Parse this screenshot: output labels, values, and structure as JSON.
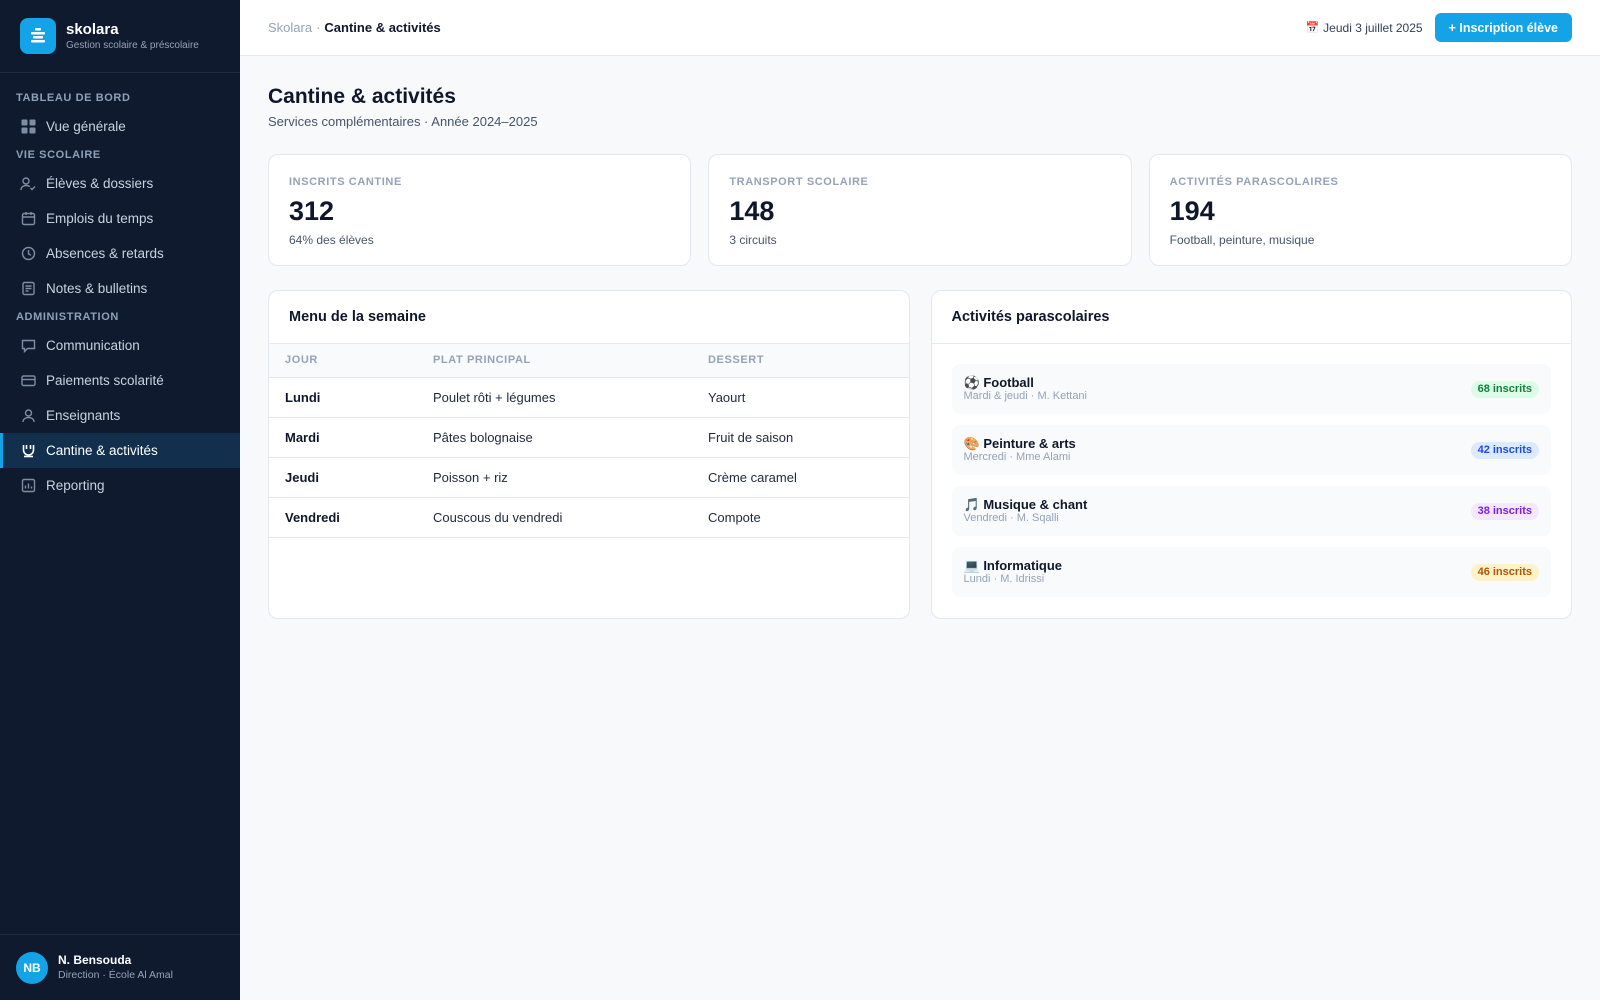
{
  "app": {
    "name": "skolara",
    "tagline": "Gestion scolaire & préscolaire"
  },
  "sidebar": {
    "sections": [
      {
        "title": "TABLEAU DE BORD",
        "items": [
          {
            "label": "Vue générale",
            "icon": "grid-icon"
          }
        ]
      },
      {
        "title": "VIE SCOLAIRE",
        "items": [
          {
            "label": "Élèves & dossiers",
            "icon": "user-check-icon"
          },
          {
            "label": "Emplois du temps",
            "icon": "calendar-icon"
          },
          {
            "label": "Absences & retards",
            "icon": "clock-icon"
          },
          {
            "label": "Notes & bulletins",
            "icon": "document-icon"
          }
        ]
      },
      {
        "title": "ADMINISTRATION",
        "items": [
          {
            "label": "Communication",
            "icon": "chat-icon"
          },
          {
            "label": "Paiements scolarité",
            "icon": "credit-card-icon"
          },
          {
            "label": "Enseignants",
            "icon": "user-icon"
          },
          {
            "label": "Cantine & activités",
            "icon": "cup-icon",
            "active": true
          },
          {
            "label": "Reporting",
            "icon": "chart-icon"
          }
        ]
      }
    ],
    "user": {
      "initials": "NB",
      "name": "N. Bensouda",
      "role": "Direction · École Al Amal"
    }
  },
  "topbar": {
    "breadcrumb_root": "Skolara",
    "breadcrumb_sep": "·",
    "breadcrumb_current": "Cantine & activités",
    "date": "Jeudi 3 juillet 2025",
    "primary_button": "+ Inscription élève"
  },
  "page": {
    "title": "Cantine & activités",
    "subtitle": "Services complémentaires · Année 2024–2025"
  },
  "kpis": [
    {
      "label": "INSCRITS CANTINE",
      "value": "312",
      "note": "64% des élèves"
    },
    {
      "label": "TRANSPORT SCOLAIRE",
      "value": "148",
      "note": "3 circuits"
    },
    {
      "label": "ACTIVITÉS PARASCOLAIRES",
      "value": "194",
      "note": "Football, peinture, musique"
    }
  ],
  "menu": {
    "title": "Menu de la semaine",
    "columns": [
      "JOUR",
      "PLAT PRINCIPAL",
      "DESSERT"
    ],
    "rows": [
      [
        "Lundi",
        "Poulet rôti + légumes",
        "Yaourt"
      ],
      [
        "Mardi",
        "Pâtes bolognaise",
        "Fruit de saison"
      ],
      [
        "Jeudi",
        "Poisson + riz",
        "Crème caramel"
      ],
      [
        "Vendredi",
        "Couscous du vendredi",
        "Compote"
      ]
    ]
  },
  "activities": {
    "title": "Activités parascolaires",
    "items": [
      {
        "emoji": "⚽",
        "name": "Football",
        "meta": "Mardi & jeudi · M. Kettani",
        "badge": "68 inscrits",
        "badge_bg": "#dcfce7",
        "badge_fg": "#15803d"
      },
      {
        "emoji": "🎨",
        "name": "Peinture & arts",
        "meta": "Mercredi · Mme Alami",
        "badge": "42 inscrits",
        "badge_bg": "#dbeafe",
        "badge_fg": "#1d4ed8"
      },
      {
        "emoji": "🎵",
        "name": "Musique & chant",
        "meta": "Vendredi · M. Sqalli",
        "badge": "38 inscrits",
        "badge_bg": "#f3e8ff",
        "badge_fg": "#7e22ce"
      },
      {
        "emoji": "💻",
        "name": "Informatique",
        "meta": "Lundi · M. Idrissi",
        "badge": "46 inscrits",
        "badge_bg": "#fef3c7",
        "badge_fg": "#b45309"
      }
    ]
  },
  "colors": {
    "sidebar_bg": "#0f1a2e",
    "accent": "#14a3e6",
    "active_bg": "#12304d"
  }
}
